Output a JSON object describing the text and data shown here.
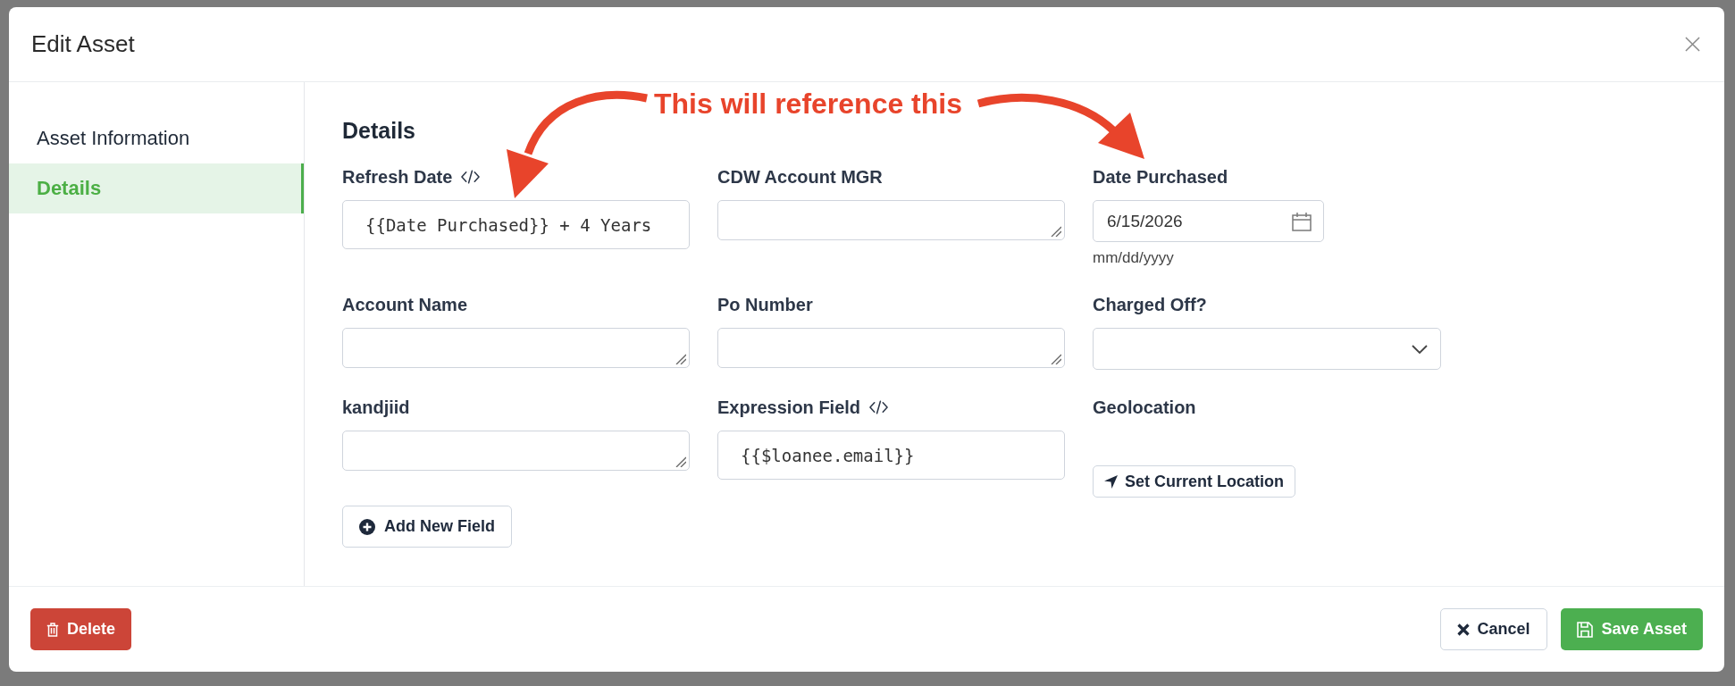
{
  "modal": {
    "title": "Edit Asset"
  },
  "sidebar": {
    "items": [
      {
        "label": "Asset Information",
        "selected": false
      },
      {
        "label": "Details",
        "selected": true
      }
    ]
  },
  "section": {
    "title": "Details"
  },
  "fields": [
    {
      "label": "Refresh Date",
      "kind": "expression",
      "value": "{{Date Purchased}} + 4 Years"
    },
    {
      "label": "CDW Account MGR",
      "kind": "textarea"
    },
    {
      "label": "Date Purchased",
      "kind": "date",
      "value": "6/15/2026",
      "hint": "mm/dd/yyyy"
    },
    {
      "label": "Account Name",
      "kind": "textarea"
    },
    {
      "label": "Po Number",
      "kind": "textarea"
    },
    {
      "label": "Charged Off?",
      "kind": "select"
    },
    {
      "label": "kandjiid",
      "kind": "textarea"
    },
    {
      "label": "Expression Field",
      "kind": "expression",
      "value": "{{$loanee.email}}"
    },
    {
      "label": "Geolocation",
      "kind": "location",
      "button": "Set Current Location"
    }
  ],
  "add_field_button": "Add New Field",
  "footer": {
    "delete_button": "Delete",
    "cancel_button": "Cancel",
    "save_button": "Save Asset"
  },
  "annotation": {
    "text": "This will reference this"
  }
}
